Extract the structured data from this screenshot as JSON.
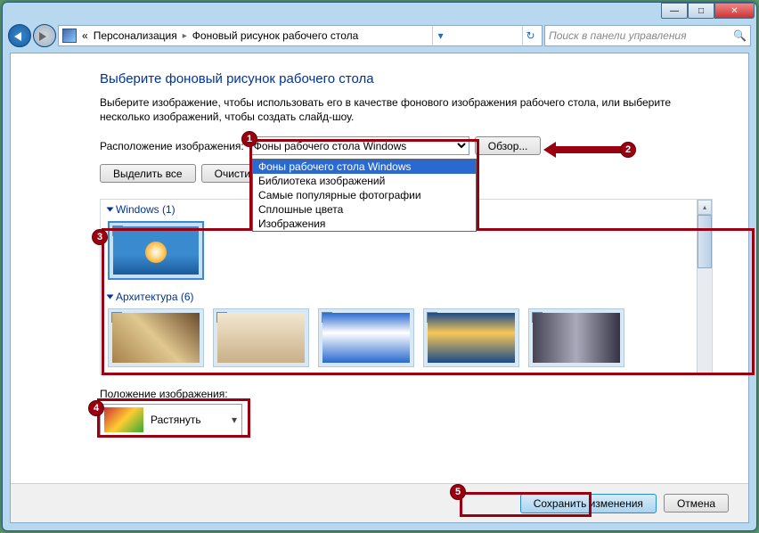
{
  "window": {
    "min_label": "—",
    "max_label": "□",
    "close_label": "✕"
  },
  "addressbar": {
    "prefix": "«",
    "part1": "Персонализация",
    "sep": "▸",
    "part2": "Фоновый рисунок рабочего стола"
  },
  "search": {
    "placeholder": "Поиск в панели управления"
  },
  "page": {
    "title": "Выберите фоновый рисунок рабочего стола",
    "description": "Выберите изображение, чтобы использовать его в качестве фонового изображения рабочего стола, или выберите несколько изображений, чтобы создать слайд-шоу.",
    "location_label": "Расположение изображения:",
    "combo_selected": "Фоны рабочего стола Windows",
    "combo_options": [
      "Фоны рабочего стола Windows",
      "Библиотека изображений",
      "Самые популярные фотографии",
      "Сплошные цвета",
      "Изображения"
    ],
    "browse_btn": "Обзор...",
    "select_all_btn": "Выделить все",
    "clear_all_btn": "Очисти",
    "group_windows": "Windows (1)",
    "group_arch": "Архитектура (6)",
    "position_label": "Положение изображения:",
    "position_value": "Растянуть"
  },
  "footer": {
    "save_btn": "Сохранить изменения",
    "cancel_btn": "Отмена"
  },
  "callouts": {
    "c1": "1",
    "c2": "2",
    "c3": "3",
    "c4": "4",
    "c5": "5"
  }
}
